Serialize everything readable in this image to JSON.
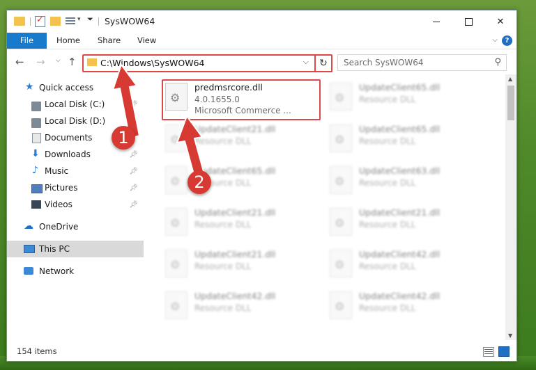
{
  "window": {
    "title": "SysWOW64",
    "controls": {
      "minimize": "minimize",
      "maximize": "maximize",
      "close": "✕"
    }
  },
  "ribbon": {
    "tabs": [
      "File",
      "Home",
      "Share",
      "View"
    ],
    "help": "?"
  },
  "address_bar": {
    "path": "C:\\Windows\\SysWOW64",
    "dropdown": "⌵",
    "refresh": "↻"
  },
  "search": {
    "placeholder": "Search SysWOW64"
  },
  "nav_pane": {
    "quick_access": "Quick access",
    "items": [
      {
        "label": "Local Disk (C:)",
        "pinned": true
      },
      {
        "label": "Local Disk (D:)",
        "pinned": true
      },
      {
        "label": "Documents",
        "pinned": true
      },
      {
        "label": "Downloads",
        "pinned": true
      },
      {
        "label": "Music",
        "pinned": true
      },
      {
        "label": "Pictures",
        "pinned": true
      },
      {
        "label": "Videos",
        "pinned": true
      }
    ],
    "onedrive": "OneDrive",
    "this_pc": "This PC",
    "network": "Network"
  },
  "files": {
    "highlighted": {
      "name": "predmsrcore.dll",
      "version": "4.0.1655.0",
      "description": "Microsoft Commerce ..."
    },
    "left_column": [
      {
        "name": "UpdateClient21.dll",
        "type": "Resource DLL"
      },
      {
        "name": "UpdateClient65.dll",
        "type": "Resource DLL"
      },
      {
        "name": "UpdateClient21.dll",
        "type": "Resource DLL"
      },
      {
        "name": "UpdateClient21.dll",
        "type": "Resource DLL"
      },
      {
        "name": "UpdateClient42.dll",
        "type": "Resource DLL"
      }
    ],
    "right_column": [
      {
        "name": "UpdateClient65.dll",
        "type": "Resource DLL"
      },
      {
        "name": "UpdateClient65.dll",
        "type": "Resource DLL"
      },
      {
        "name": "UpdateClient63.dll",
        "type": "Resource DLL"
      },
      {
        "name": "UpdateClient21.dll",
        "type": "Resource DLL"
      },
      {
        "name": "UpdateClient42.dll",
        "type": "Resource DLL"
      },
      {
        "name": "UpdateClient42.dll",
        "type": "Resource DLL"
      }
    ]
  },
  "status_bar": {
    "item_count": "154 items"
  },
  "annotations": {
    "step1": "1",
    "step2": "2",
    "color": "#d63a32"
  }
}
